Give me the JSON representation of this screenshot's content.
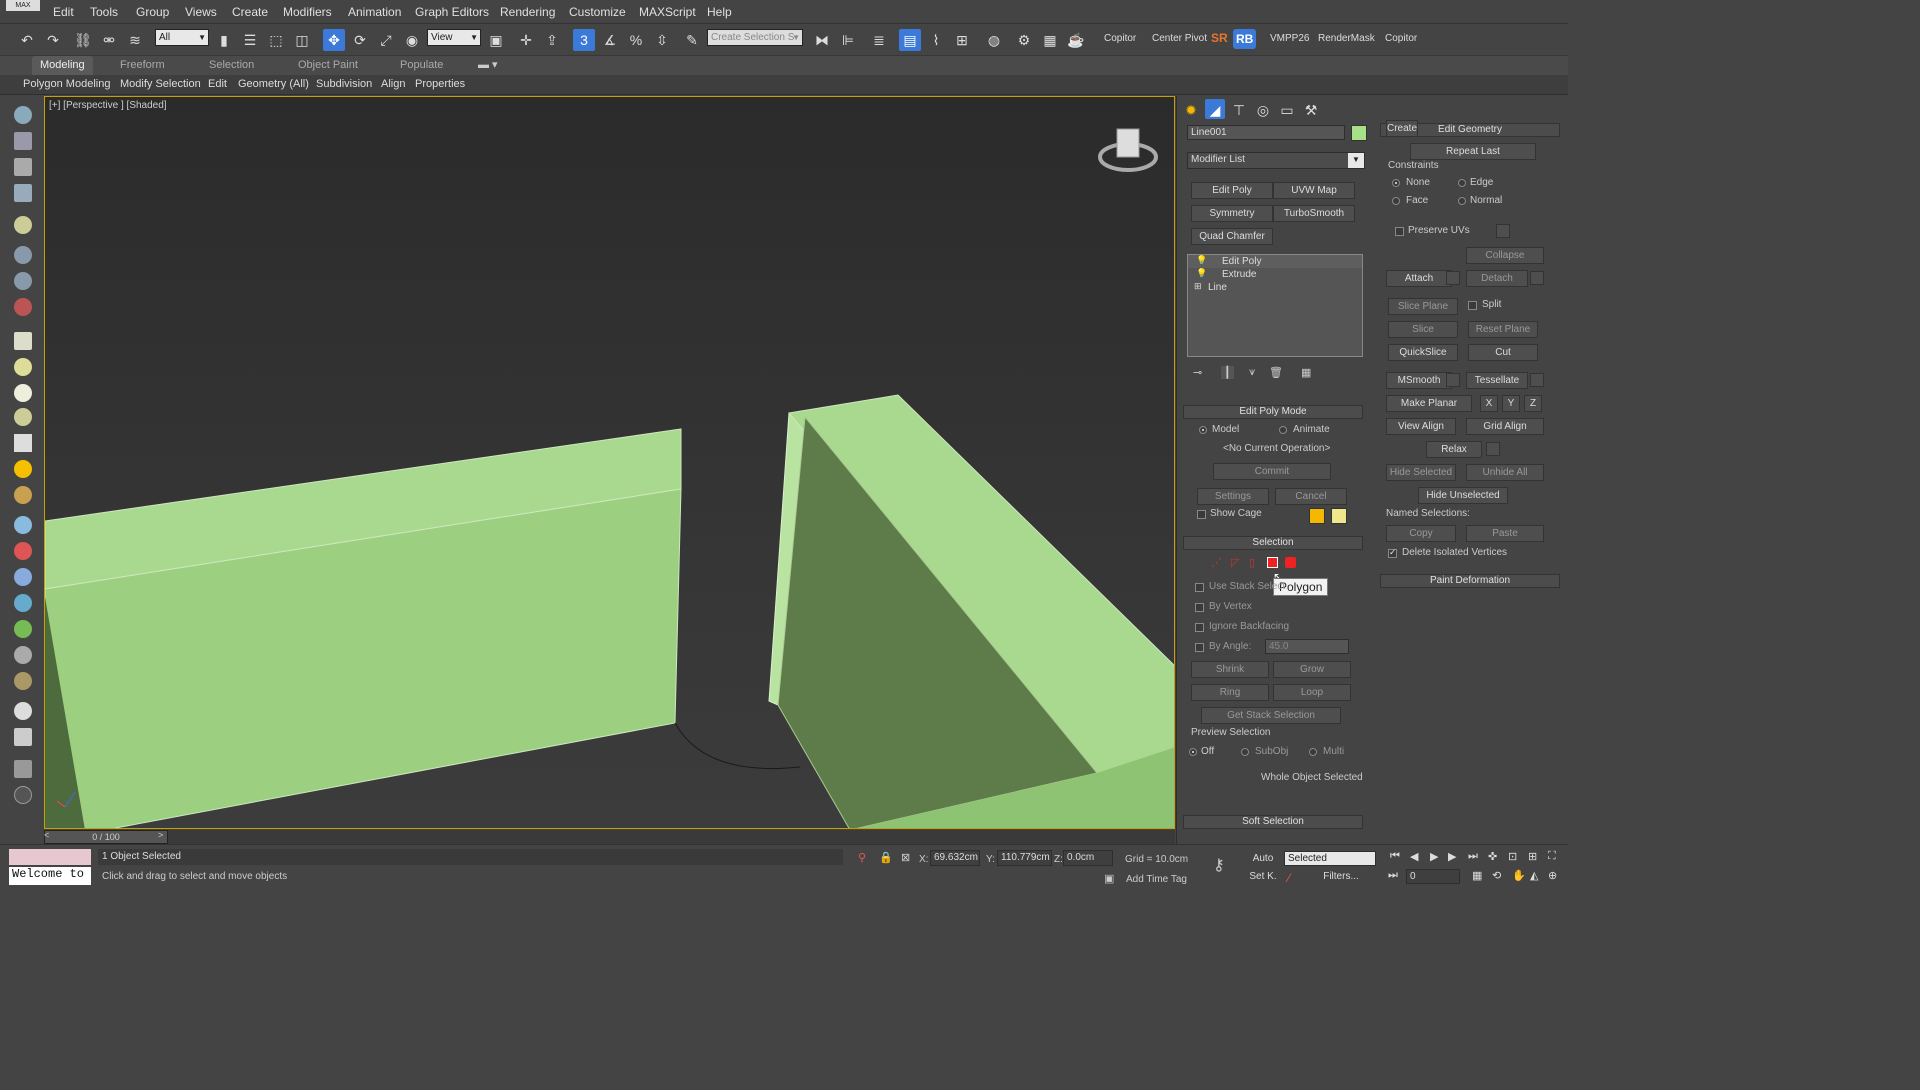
{
  "app": {
    "logo": "MAX"
  },
  "menu": [
    "Edit",
    "Tools",
    "Group",
    "Views",
    "Create",
    "Modifiers",
    "Animation",
    "Graph Editors",
    "Rendering",
    "Customize",
    "MAXScript",
    "Help"
  ],
  "toolbar": {
    "selection_filter": "All",
    "ref_coord": "View",
    "named_selection_placeholder": "Create Selection S",
    "snap_value": "3",
    "scripts": [
      "Copitor",
      "Center Pivot",
      "SR",
      "RB",
      "VMPP26",
      "RenderMask",
      "Copitor"
    ]
  },
  "ribbon": {
    "tabs": [
      "Modeling",
      "Freeform",
      "Selection",
      "Object Paint",
      "Populate"
    ],
    "active_tab": "Modeling",
    "sub": [
      "Polygon Modeling",
      "Modify Selection",
      "Edit",
      "Geometry (All)",
      "Subdivision",
      "Align",
      "Properties"
    ]
  },
  "viewport": {
    "label": "[+] [Perspective ] [Shaded]"
  },
  "timeline": {
    "frame": "0 / 100"
  },
  "command_panel": {
    "object_name": "Line001",
    "object_color": "#a8e089",
    "modifier_list": "Modifier List",
    "modifier_buttons": [
      "Edit Poly",
      "UVW Map",
      "Symmetry",
      "TurboSmooth",
      "Quad Chamfer"
    ],
    "stack": [
      "Edit Poly",
      "Extrude",
      "Line"
    ],
    "edit_poly_mode": {
      "title": "Edit Poly Mode",
      "model": "Model",
      "animate": "Animate",
      "current_op": "<No Current Operation>",
      "commit": "Commit",
      "settings": "Settings",
      "cancel": "Cancel",
      "show_cage": "Show Cage",
      "cage_colors": [
        "#f5b800",
        "#f0e68c"
      ]
    },
    "selection": {
      "title": "Selection",
      "tooltip": "Polygon",
      "use_stack": "Use Stack Select",
      "by_vertex": "By Vertex",
      "ignore_backfacing": "Ignore Backfacing",
      "by_angle": "By Angle:",
      "angle_value": "45.0",
      "shrink": "Shrink",
      "grow": "Grow",
      "ring": "Ring",
      "loop": "Loop",
      "get_stack": "Get Stack Selection",
      "preview_title": "Preview Selection",
      "preview_off": "Off",
      "preview_subobj": "SubObj",
      "preview_multi": "Multi",
      "whole_object": "Whole Object Selected"
    },
    "soft_selection": "Soft Selection"
  },
  "edit_geometry": {
    "title": "Edit Geometry",
    "repeat_last": "Repeat Last",
    "constraints": "Constraints",
    "none": "None",
    "edge": "Edge",
    "face": "Face",
    "normal": "Normal",
    "preserve_uvs": "Preserve UVs",
    "create": "Create",
    "collapse": "Collapse",
    "attach": "Attach",
    "detach": "Detach",
    "slice_plane": "Slice Plane",
    "split": "Split",
    "slice": "Slice",
    "reset_plane": "Reset Plane",
    "quickslice": "QuickSlice",
    "cut": "Cut",
    "msmooth": "MSmooth",
    "tessellate": "Tessellate",
    "make_planar": "Make Planar",
    "x": "X",
    "y": "Y",
    "z": "Z",
    "view_align": "View Align",
    "grid_align": "Grid Align",
    "relax": "Relax",
    "hide_selected": "Hide Selected",
    "unhide_all": "Unhide All",
    "hide_unselected": "Hide Unselected",
    "named_selections": "Named Selections:",
    "copy": "Copy",
    "paste": "Paste",
    "delete_isolated": "Delete Isolated Vertices",
    "paint_deformation": "Paint Deformation"
  },
  "status": {
    "welcome": "Welcome to",
    "selected": "1 Object Selected",
    "prompt": "Click and drag to select and move objects",
    "x_label": "X:",
    "x": "69.632cm",
    "y_label": "Y:",
    "y": "110.779cm",
    "z_label": "Z:",
    "z": "0.0cm",
    "grid": "Grid = 10.0cm",
    "add_time_tag": "Add Time Tag",
    "auto": "Auto",
    "set_key": "Set K.",
    "key_filter": "Selected",
    "filters": "Filters...",
    "frame_field": "0"
  }
}
